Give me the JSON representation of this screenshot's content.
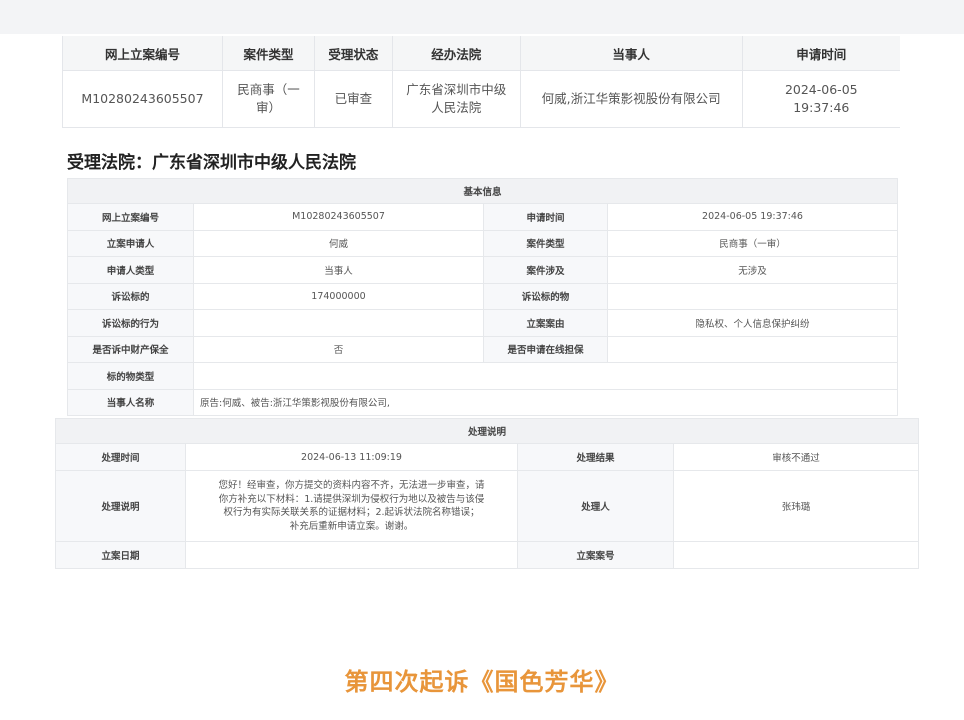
{
  "summary": {
    "headers": [
      "网上立案编号",
      "案件类型",
      "受理状态",
      "经办法院",
      "当事人",
      "申请时间"
    ],
    "row": {
      "case_no": "M10280243605507",
      "case_type": "民商事（一审）",
      "status": "已审查",
      "court": "广东省深圳市中级人民法院",
      "parties": "何威,浙江华策影视股份有限公司",
      "time_date": "2024-06-05",
      "time_clock": "19:37:46"
    }
  },
  "court_title": "受理法院：广东省深圳市中级人民法院",
  "basic": {
    "section_title": "基本信息",
    "online_no_label": "网上立案编号",
    "online_no": "M10280243605507",
    "apply_time_label": "申请时间",
    "apply_time": "2024-06-05 19:37:46",
    "applicant_label": "立案申请人",
    "applicant": "何威",
    "case_type_label": "案件类型",
    "case_type": "民商事（一审）",
    "applicant_type_label": "申请人类型",
    "applicant_type": "当事人",
    "involve_label": "案件涉及",
    "involve": "无涉及",
    "amount_label": "诉讼标的",
    "amount": "174000000",
    "object_label": "诉讼标的物",
    "object": "",
    "act_label": "诉讼标的行为",
    "act": "",
    "cause_label": "立案案由",
    "cause": "隐私权、个人信息保护纠纷",
    "preserve_label": "是否诉中财产保全",
    "preserve": "否",
    "guarantee_label": "是否申请在线担保",
    "guarantee": "",
    "object_type_label": "标的物类型",
    "object_type": "",
    "party_name_label": "当事人名称",
    "party_name": "原告:何威、被告:浙江华策影视股份有限公司,"
  },
  "process": {
    "section_title": "处理说明",
    "time_label": "处理时间",
    "time": "2024-06-13 11:09:19",
    "result_label": "处理结果",
    "result": "审核不通过",
    "desc_label": "处理说明",
    "desc_line1": "您好！经审查，你方提交的资料内容不齐，无法进一步审查，请",
    "desc_line2": "你方补充以下材料：1.请提供深圳为侵权行为地以及被告与该侵",
    "desc_line3": "权行为有实际关联关系的证据材料；2.起诉状法院名称错误；",
    "desc_line4": "补充后重新申请立案。谢谢。",
    "handler_label": "处理人",
    "handler": "张玮璐",
    "file_date_label": "立案日期",
    "file_date": "",
    "file_no_label": "立案案号",
    "file_no": ""
  },
  "caption": "第四次起诉《国色芳华》",
  "colors": {
    "caption": "#e8953a",
    "header_bg": "#f5f6f7",
    "border": "#e4e6ea"
  }
}
